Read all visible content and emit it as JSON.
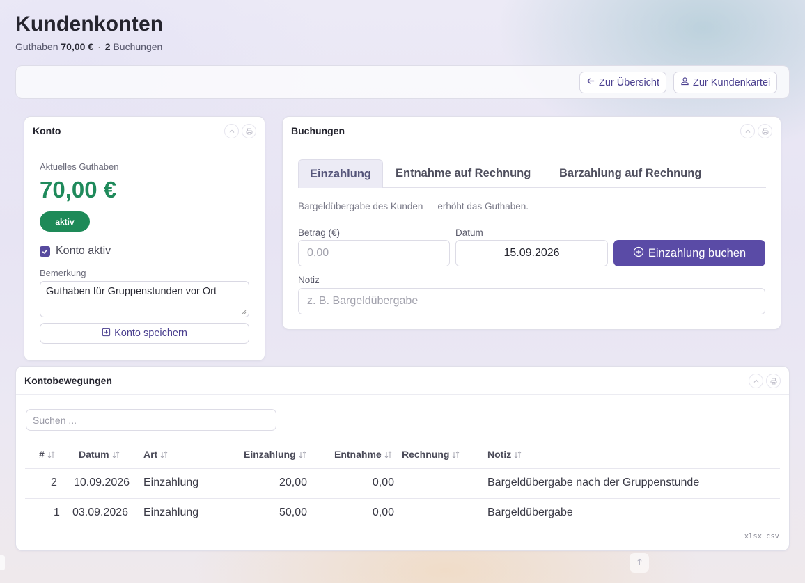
{
  "page": {
    "title": "Kundenkonten",
    "subtitle_prefix": "Guthaben",
    "subtitle_balance": "70,00 €",
    "subtitle_count": "2",
    "subtitle_suffix": "Buchungen"
  },
  "toolbar": {
    "back_label": "Zur Übersicht",
    "customer_label": "Zur Kundenkartei"
  },
  "account": {
    "title": "Konto",
    "balance_label": "Aktuelles Guthaben",
    "balance": "70,00 €",
    "status_badge": "aktiv",
    "active_checkbox_label": "Konto aktiv",
    "active_checked": true,
    "remark_label": "Bemerkung",
    "remark_value": "Guthaben für Gruppenstunden vor Ort",
    "save_label": "Konto speichern"
  },
  "bookings": {
    "title": "Buchungen",
    "tabs": [
      "Einzahlung",
      "Entnahme auf Rechnung",
      "Barzahlung auf Rechnung"
    ],
    "active_tab": "Einzahlung",
    "description": "Bargeldübergabe des Kunden — erhöht das Guthaben.",
    "amount_label": "Betrag (€)",
    "amount_placeholder": "0,00",
    "date_label": "Datum",
    "date_value": "15.09.2026",
    "submit_label": "Einzahlung buchen",
    "note_label": "Notiz",
    "note_placeholder": "z. B. Bargeldübergabe"
  },
  "movements": {
    "title": "Kontobewegungen",
    "search_placeholder": "Suchen ...",
    "columns": [
      "#",
      "Datum",
      "Art",
      "Einzahlung",
      "Entnahme",
      "Rechnung",
      "Notiz"
    ],
    "rows": [
      {
        "nr": "2",
        "datum": "10.09.2026",
        "art": "Einzahlung",
        "einzahlung": "20,00",
        "entnahme": "0,00",
        "rechnung": "",
        "notiz": "Bargeldübergabe nach der Gruppenstunde"
      },
      {
        "nr": "1",
        "datum": "03.09.2026",
        "art": "Einzahlung",
        "einzahlung": "50,00",
        "entnahme": "0,00",
        "rechnung": "",
        "notiz": "Bargeldübergabe"
      }
    ],
    "export_xlsx": "xlsx",
    "export_csv": "csv"
  },
  "colors": {
    "accent": "#5a4ba6",
    "positive": "#1f8a5b",
    "badge": "#1e8a58"
  },
  "icons": [
    "arrow-left-icon",
    "user-icon",
    "chevron-up-icon",
    "printer-icon",
    "checkbox-icon",
    "save-icon",
    "plus-circle-icon",
    "sort-icon",
    "arrow-up-icon"
  ]
}
